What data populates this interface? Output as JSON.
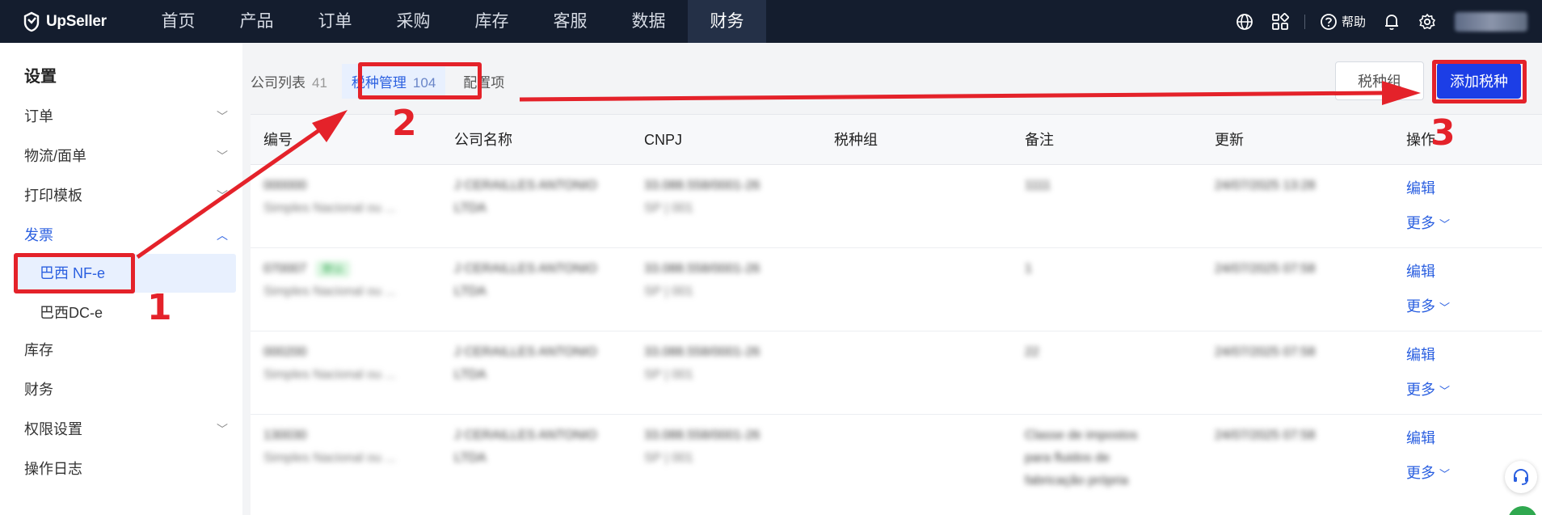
{
  "brand": {
    "name": "UpSeller"
  },
  "nav": [
    {
      "label": "首页"
    },
    {
      "label": "产品"
    },
    {
      "label": "订单"
    },
    {
      "label": "采购"
    },
    {
      "label": "库存"
    },
    {
      "label": "客服"
    },
    {
      "label": "数据"
    },
    {
      "label": "财务",
      "active": true
    }
  ],
  "topright": {
    "help_label": "帮助"
  },
  "sidebar": {
    "title": "设置",
    "items": [
      {
        "label": "订单"
      },
      {
        "label": "物流/面单"
      },
      {
        "label": "打印模板"
      },
      {
        "label": "发票"
      },
      {
        "label": "巴西 NF-e"
      },
      {
        "label": "巴西DC-e"
      },
      {
        "label": "库存"
      },
      {
        "label": "财务"
      },
      {
        "label": "权限设置"
      },
      {
        "label": "操作日志"
      }
    ]
  },
  "tabs": [
    {
      "label": "公司列表",
      "count": "41"
    },
    {
      "label": "税种管理",
      "count": "104",
      "active": true
    },
    {
      "label": "配置项",
      "count": ""
    }
  ],
  "buttons": {
    "tax_group": "税种组",
    "add_tax": "添加税种"
  },
  "table": {
    "headers": [
      "编号",
      "公司名称",
      "CNPJ",
      "税种组",
      "备注",
      "更新",
      "操作"
    ],
    "rows": [
      {
        "id": "000000",
        "sub": "Simples Nacional ou ...",
        "company1": "J CERAILLES ANTONIO",
        "company2": "LTDA",
        "cnpj1": "33.088.558/0001-26",
        "cnpj2": "SP | 001",
        "note": "1111",
        "updated": "24/07/2025 13:28",
        "edit": "编辑",
        "more": "更多"
      },
      {
        "id": "070007",
        "badge": "默认",
        "sub": "Simples Nacional ou ...",
        "company1": "J CERAILLES ANTONIO",
        "company2": "LTDA",
        "cnpj1": "33.088.558/0001-26",
        "cnpj2": "SP | 001",
        "note": "1",
        "updated": "24/07/2025 07:58",
        "edit": "编辑",
        "more": "更多"
      },
      {
        "id": "000200",
        "sub": "Simples Nacional ou ...",
        "company1": "J CERAILLES ANTONIO",
        "company2": "LTDA",
        "cnpj1": "33.088.558/0001-26",
        "cnpj2": "SP | 001",
        "note": "22",
        "updated": "24/07/2025 07:58",
        "edit": "编辑",
        "more": "更多"
      },
      {
        "id": "130030",
        "sub": "Simples Nacional ou ...",
        "company1": "J CERAILLES ANTONIO",
        "company2": "LTDA",
        "cnpj1": "33.088.558/0001-26",
        "cnpj2": "SP | 001",
        "note": "Classe de impostos",
        "note2": "para fluidos de",
        "note3": "fabricação própria",
        "updated": "24/07/2025 07:58",
        "edit": "编辑",
        "more": "更多"
      }
    ]
  },
  "annotations": {
    "n1": "1",
    "n2": "2",
    "n3": "3",
    "color": "#e4222a"
  },
  "colors": {
    "accent": "#2a5fe0",
    "primary_button": "#1c3ee6",
    "topbar": "#141d2e"
  }
}
